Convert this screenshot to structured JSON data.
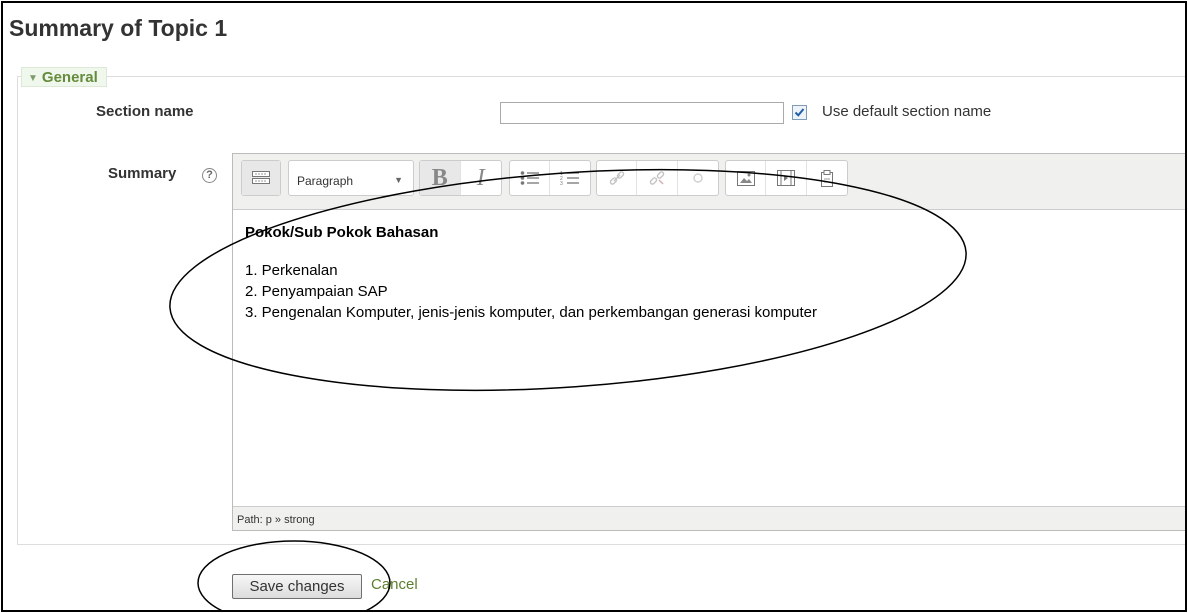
{
  "page": {
    "title": "Summary of Topic 1"
  },
  "fieldset": {
    "legend": "General"
  },
  "section_name": {
    "label": "Section name",
    "value": "",
    "use_default_checked": true,
    "use_default_label": "Use default section name"
  },
  "summary": {
    "label": "Summary",
    "toolbar": {
      "format_value": "Paragraph",
      "icons": [
        "toolbar-toggle-icon",
        "bold-icon",
        "italic-icon",
        "bullet-list-icon",
        "numbered-list-icon",
        "link-icon",
        "unlink-icon",
        "anchor-icon",
        "image-icon",
        "media-icon",
        "paste-icon"
      ]
    },
    "content": {
      "heading": "Pokok/Sub Pokok Bahasan",
      "items": [
        "1. Perkenalan",
        "2. Penyampaian SAP",
        "3. Pengenalan Komputer, jenis-jenis komputer, dan perkembangan generasi komputer"
      ]
    },
    "path": "Path: p » strong"
  },
  "actions": {
    "save_label": "Save changes",
    "cancel_label": "Cancel"
  },
  "colors": {
    "accent_green": "#648c3c",
    "link_green": "#5c7f2e",
    "checkbox_check": "#1f5fa8"
  }
}
